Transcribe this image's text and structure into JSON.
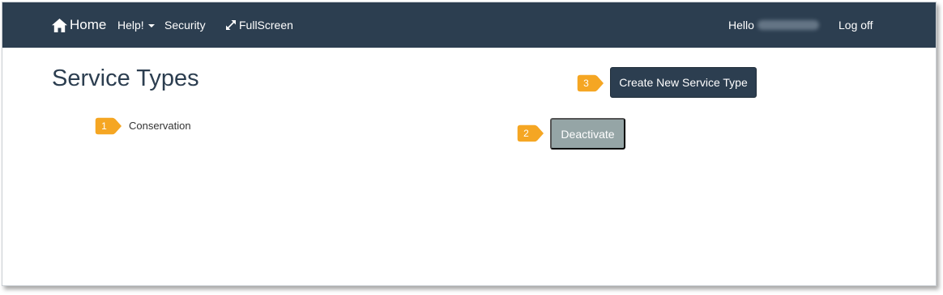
{
  "navbar": {
    "home_label": "Home",
    "help_label": "Help!",
    "security_label": "Security",
    "fullscreen_label": "FullScreen",
    "hello_label": "Hello",
    "logoff_label": "Log off"
  },
  "page": {
    "title": "Service Types",
    "service_types": [
      "Conservation"
    ]
  },
  "actions": {
    "create_label": "Create New Service Type",
    "deactivate_label": "Deactivate"
  },
  "callouts": [
    "1",
    "2",
    "3"
  ],
  "colors": {
    "navbar": "#2c3e50",
    "primary_button": "#2c3e50",
    "disabled_button": "#95a5a6",
    "callout": "#f5a623"
  },
  "icons": {
    "home": "home-icon",
    "fullscreen": "expand-arrows-icon",
    "help_menu": "caret-down-icon"
  }
}
